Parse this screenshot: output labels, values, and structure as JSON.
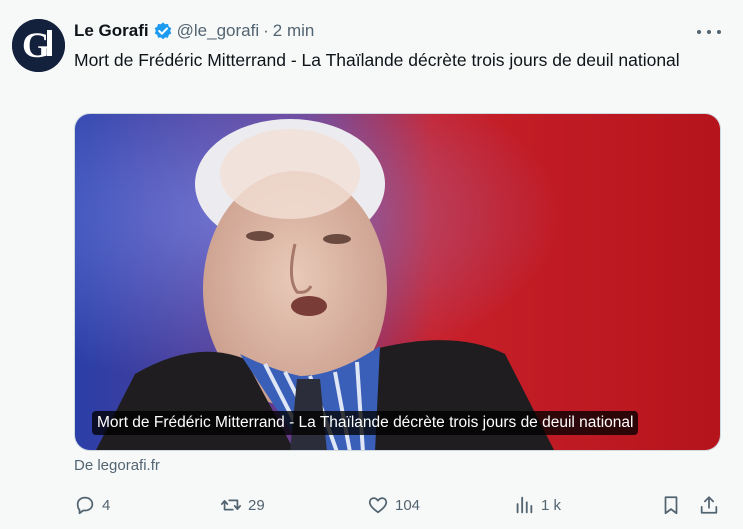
{
  "author": {
    "name": "Le Gorafi",
    "handle": "@le_gorafi",
    "separator": "·",
    "time": "2 min",
    "avatar_letter": "G",
    "verified_color": "#1d9bf0"
  },
  "tweet": {
    "text": "Mort de Frédéric Mitterrand - La Thaïlande décrète trois jours de deuil national"
  },
  "card": {
    "caption": "Mort de Frédéric Mitterrand - La Thaïlande décrète trois jours de deuil national",
    "source": "De legorafi.fr"
  },
  "actions": {
    "replies": "4",
    "retweets": "29",
    "likes": "104",
    "views": "1 k"
  },
  "icons": [
    "more-icon",
    "verified-icon",
    "reply-icon",
    "retweet-icon",
    "like-icon",
    "views-icon",
    "bookmark-icon",
    "share-icon"
  ]
}
